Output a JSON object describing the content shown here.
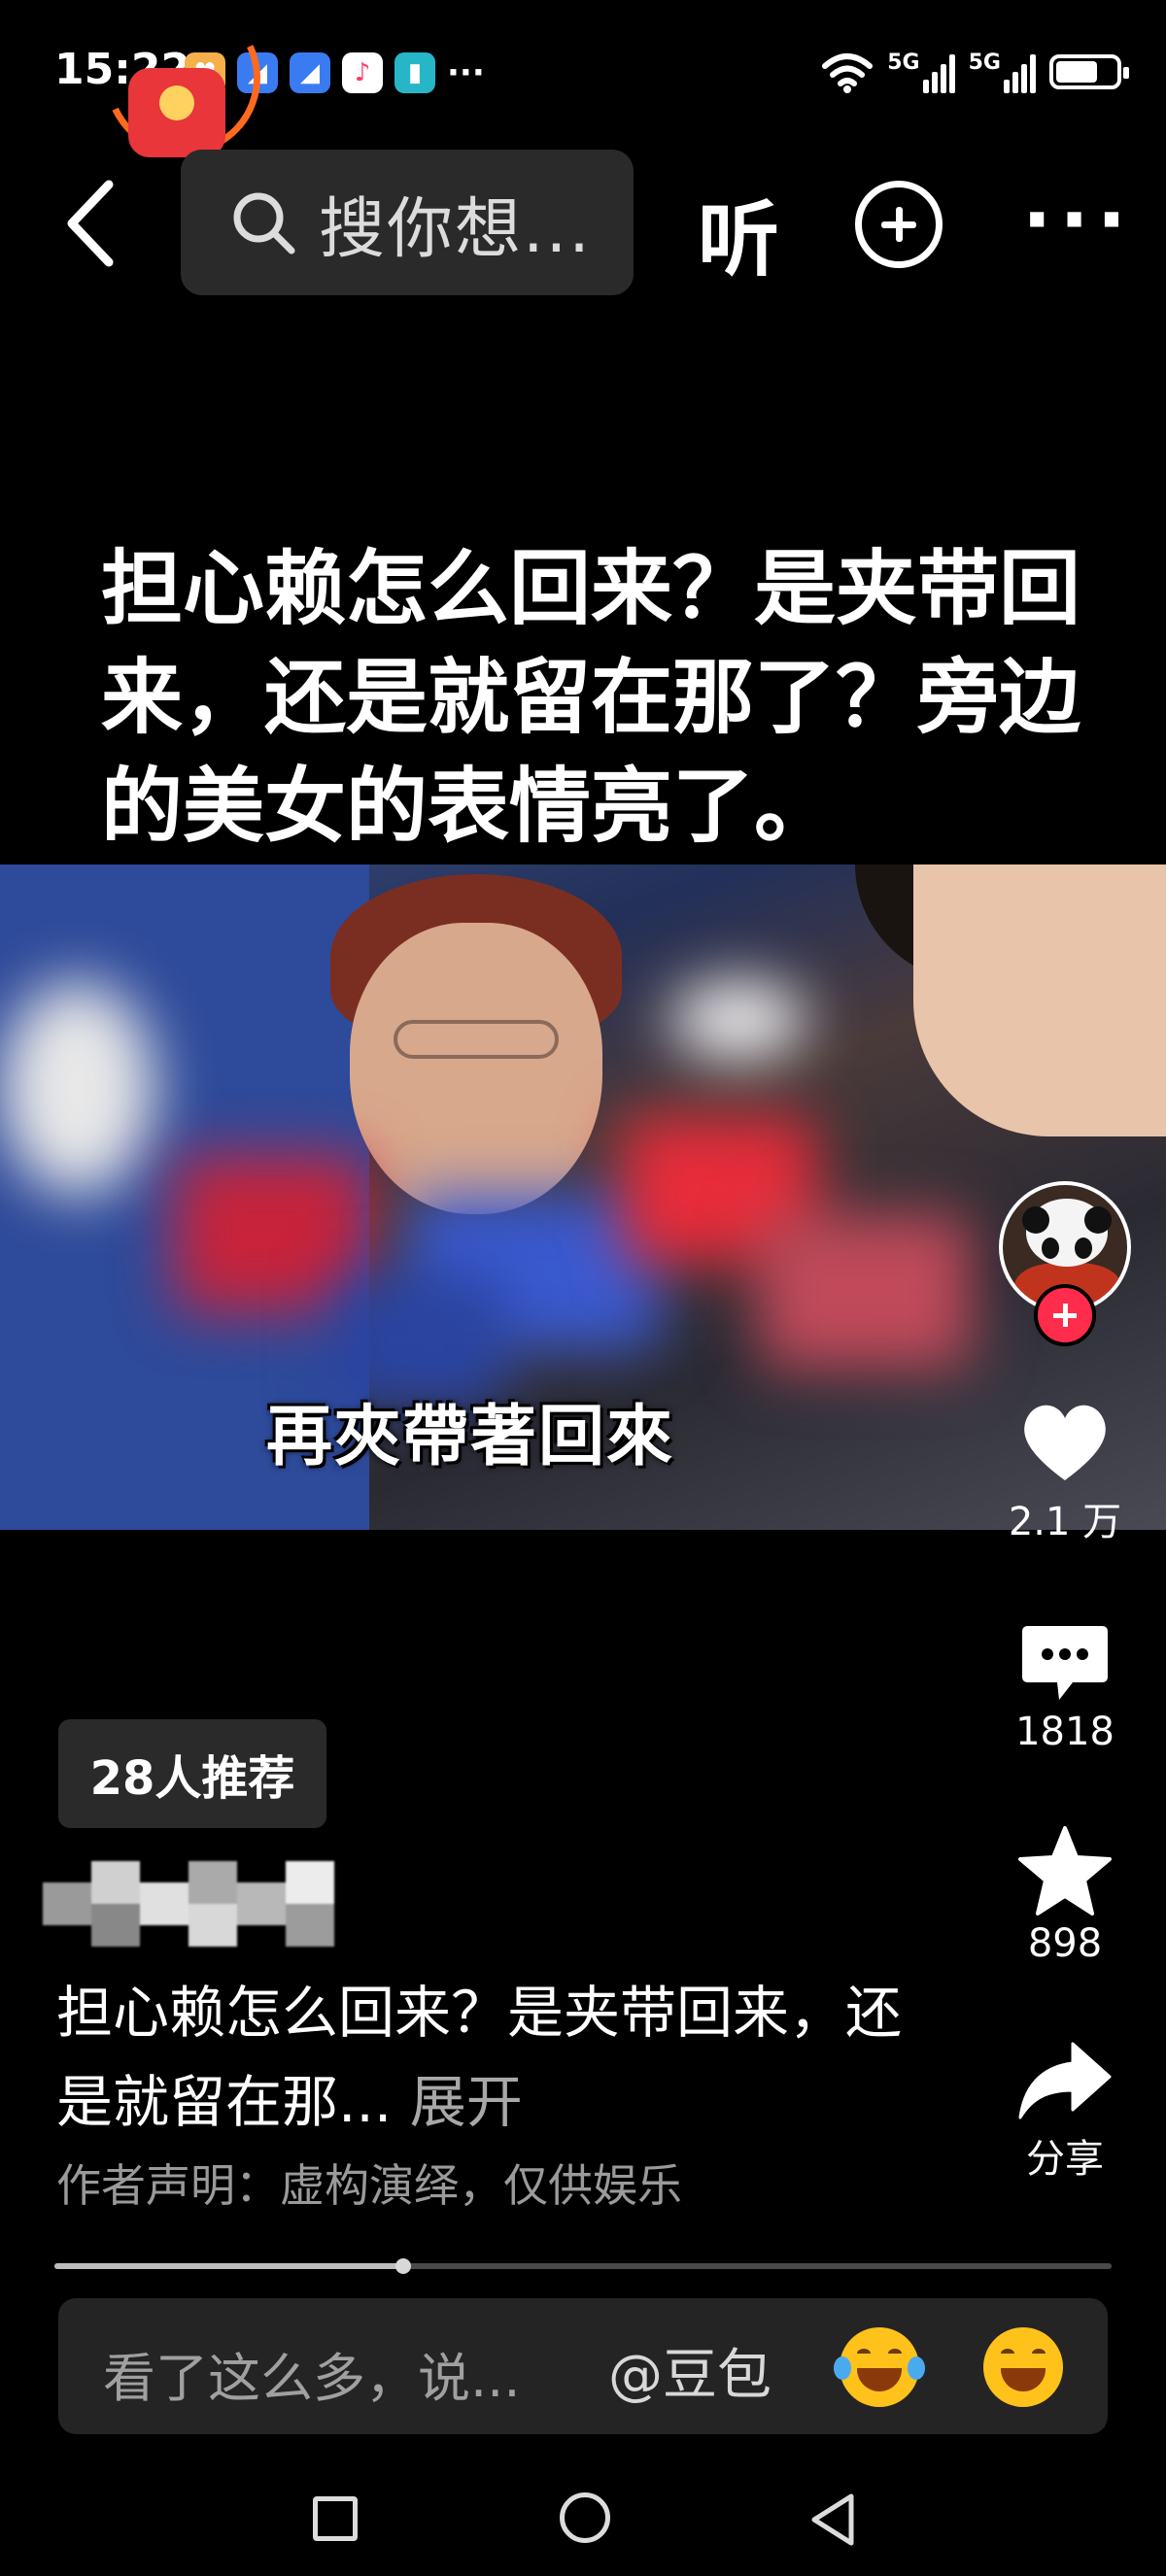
{
  "status_bar": {
    "time": "15:22",
    "network_1": "5G",
    "network_2": "5G",
    "battery_level": 0.7,
    "more_apps": "···"
  },
  "top_nav": {
    "search_placeholder": "搜你想...",
    "listen_label": "听",
    "more_label": "···"
  },
  "video": {
    "caption": "担心赖怎么回来？是夹带回来，还是就留在那了？旁边的美女的表情亮了。",
    "subtitle": "再夾帶著回來"
  },
  "rail": {
    "likes": "2.1 万",
    "comments": "1818",
    "favorites": "898",
    "share_label": "分享"
  },
  "info": {
    "recommend_badge": "28人推荐",
    "description": "担心赖怎么回来？是夹带回来，还是就留在那... ",
    "expand_label": "展开",
    "disclaimer": "作者声明：虚构演绎，仅供娱乐"
  },
  "progress": {
    "value": 0.33
  },
  "comment_bar": {
    "placeholder": "看了这么多，说...",
    "mention_label": "@豆包"
  },
  "colors": {
    "background": "#000000",
    "accent_red": "#ff2c4b",
    "panel": "#2a2a2a"
  }
}
